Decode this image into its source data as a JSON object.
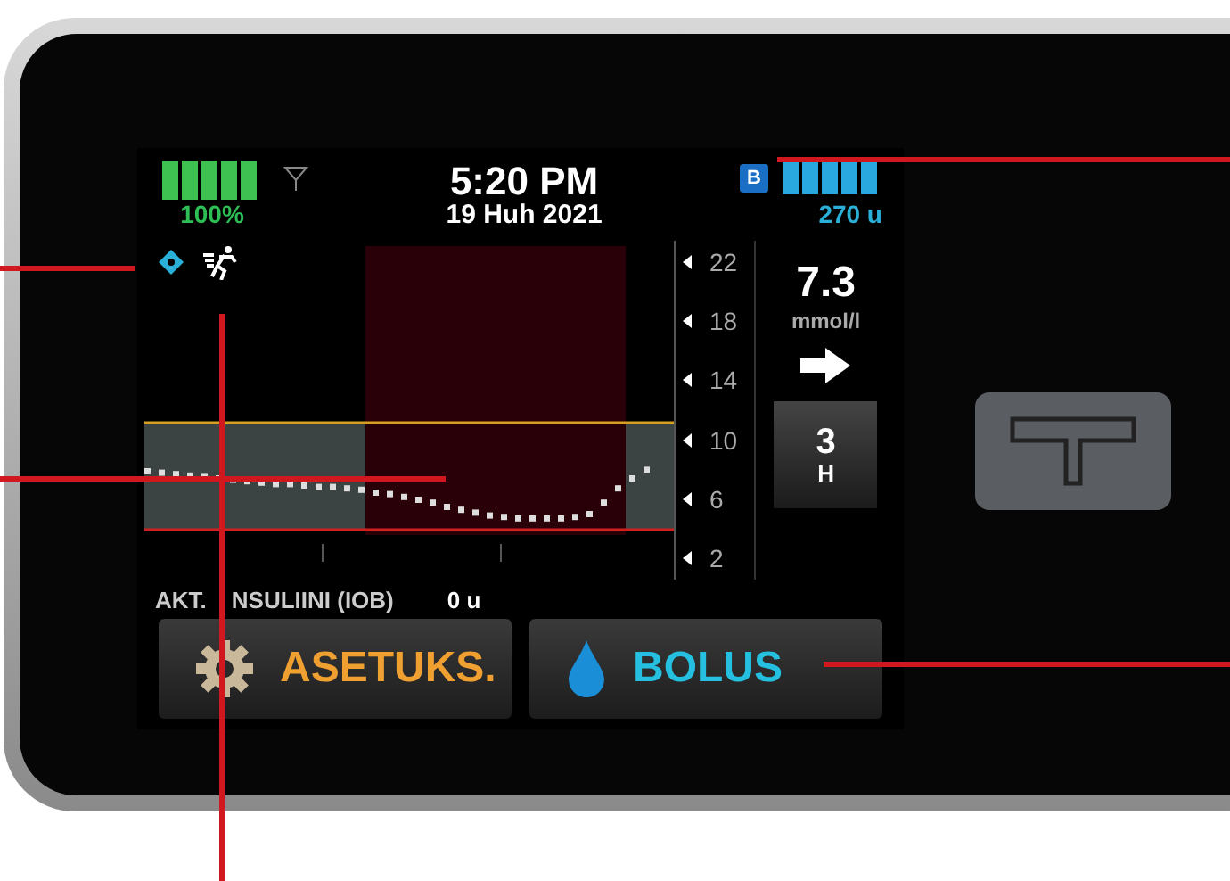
{
  "status": {
    "battery": "100%",
    "time": "5:20 PM",
    "date": "19 Huh 2021",
    "profile_badge": "B",
    "insulin": "270 u"
  },
  "chart": {
    "y_ticks": [
      "22",
      "18",
      "14",
      "10",
      "6",
      "2"
    ]
  },
  "glucose": {
    "value": "7.3",
    "unit": "mmol/l",
    "hours": "3",
    "hours_unit": "H"
  },
  "iob": {
    "label_parts": [
      "AKT.",
      "NSULIINI (IOB)"
    ],
    "value": "0 u"
  },
  "buttons": [
    {
      "kind": "settings",
      "label": "ASETUKS."
    },
    {
      "kind": "bolus",
      "label": "BOLUS"
    }
  ]
}
